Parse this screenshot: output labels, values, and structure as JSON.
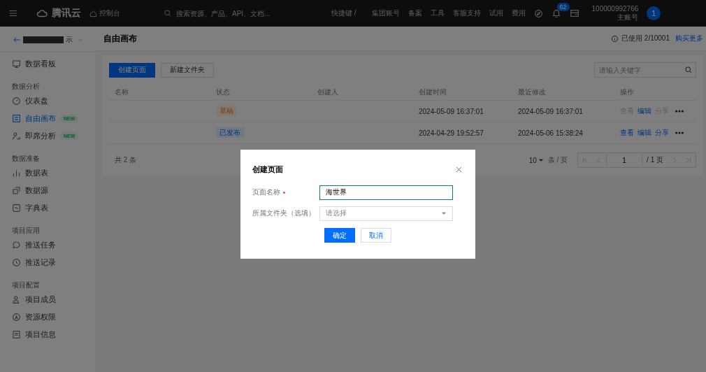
{
  "topbar": {
    "logo": "腾讯云",
    "console": "控制台",
    "search_placeholder": "搜索资源、产品、API、文档...",
    "shortcut": "快捷键 /",
    "links": [
      "集团账号",
      "备案",
      "工具",
      "客服支持",
      "试用",
      "费用"
    ],
    "notification_count": "62",
    "account_id": "100000992766",
    "account_role": "主账号",
    "avatar": "1"
  },
  "sidebar": {
    "project_name": "示",
    "sections": [
      {
        "items": [
          {
            "label": "数据看板",
            "selected": false
          }
        ]
      },
      {
        "title": "数据分析",
        "items": [
          {
            "label": "仪表盘",
            "selected": false
          },
          {
            "label": "自由画布",
            "selected": true,
            "badge": "NEW"
          },
          {
            "label": "即席分析",
            "selected": false,
            "badge": "NEW"
          }
        ]
      },
      {
        "title": "数据准备",
        "items": [
          {
            "label": "数据表",
            "selected": false
          },
          {
            "label": "数据源",
            "selected": false
          },
          {
            "label": "字典表",
            "selected": false
          }
        ]
      },
      {
        "title": "项目应用",
        "items": [
          {
            "label": "推送任务",
            "selected": false
          },
          {
            "label": "推送记录",
            "selected": false
          }
        ]
      },
      {
        "title": "项目配置",
        "items": [
          {
            "label": "项目成员",
            "selected": false
          },
          {
            "label": "资源权限",
            "selected": false
          },
          {
            "label": "项目信息",
            "selected": false
          }
        ]
      }
    ]
  },
  "page": {
    "title": "自由画布",
    "usage": "已使用 2/10001",
    "buy_link": "购买更多"
  },
  "toolbar": {
    "buttons": [
      {
        "label": "创建页面",
        "kind": "primary"
      },
      {
        "label": "新建文件夹",
        "kind": "default"
      }
    ],
    "search_placeholder": "请输入关键字"
  },
  "table": {
    "columns": [
      "名称",
      "状态",
      "创建人",
      "创建时间",
      "最近修改",
      "操作"
    ],
    "rows": [
      {
        "status": {
          "text": "草稿",
          "kind": "draft"
        },
        "created": "2024-05-09 16:37:01",
        "modified": "2024-05-09 16:37:01",
        "actions": [
          {
            "label": "查看",
            "disabled": true
          },
          {
            "label": "编辑",
            "disabled": false
          },
          {
            "label": "分享",
            "disabled": true
          }
        ]
      },
      {
        "status": {
          "text": "已发布",
          "kind": "published"
        },
        "created": "2024-04-29 19:52:57",
        "modified": "2024-05-06 15:38:24",
        "actions": [
          {
            "label": "查看",
            "disabled": false
          },
          {
            "label": "编辑",
            "disabled": false
          },
          {
            "label": "分享",
            "disabled": false
          }
        ]
      }
    ]
  },
  "pagination": {
    "total": "共 2 条",
    "page_size": "10",
    "per_page": "条 / 页",
    "page": "1",
    "pages": "/ 1 页"
  },
  "dialog": {
    "title": "创建页面",
    "fields": [
      {
        "label": "页面名称",
        "required": true,
        "kind": "text",
        "value": "海世界",
        "focused": true
      },
      {
        "label": "所属文件夹（选填）",
        "kind": "select",
        "placeholder": "请选择",
        "focused": false
      }
    ],
    "buttons": [
      {
        "label": "确定",
        "kind": "primary"
      },
      {
        "label": "取消",
        "kind": "default"
      }
    ]
  }
}
